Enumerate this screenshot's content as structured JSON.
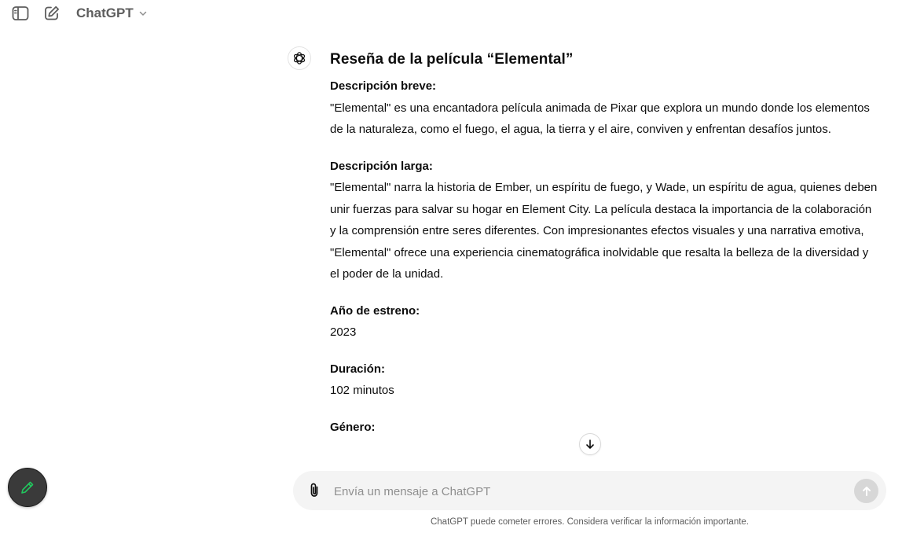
{
  "header": {
    "model_name": "ChatGPT"
  },
  "icons": {
    "sidebar_toggle": "sidebar-toggle-icon",
    "new_chat": "pencil-square-icon",
    "chevron": "chevron-down-icon",
    "assistant": "openai-logo-icon",
    "scroll_down": "arrow-down-icon",
    "attach": "paperclip-icon",
    "send": "arrow-up-icon",
    "fab": "pencil-icon"
  },
  "message": {
    "title": "Reseña de la película “Elemental”",
    "sections": [
      {
        "label": "Descripción breve:",
        "text": "\"Elemental\" es una encantadora película animada de Pixar que explora un mundo donde los elementos de la naturaleza, como el fuego, el agua, la tierra y el aire, conviven y enfrentan desafíos juntos."
      },
      {
        "label": "Descripción larga:",
        "text": "\"Elemental\" narra la historia de Ember, un espíritu de fuego, y Wade, un espíritu de agua, quienes deben unir fuerzas para salvar su hogar en Element City. La película destaca la importancia de la colaboración y la comprensión entre seres diferentes. Con impresionantes efectos visuales y una narrativa emotiva, \"Elemental\" ofrece una experiencia cinematográfica inolvidable que resalta la belleza de la diversidad y el poder de la unidad."
      },
      {
        "label": "Año de estreno:",
        "text": "2023"
      },
      {
        "label": "Duración:",
        "text": "102 minutos"
      },
      {
        "label": "Género:",
        "text": ""
      }
    ]
  },
  "composer": {
    "placeholder": "Envía un mensaje a ChatGPT"
  },
  "footer": {
    "disclaimer": "ChatGPT puede cometer errores. Considera verificar la información importante."
  },
  "colors": {
    "fab_icon": "#22c55e",
    "send_bg": "#d7d7d7"
  }
}
